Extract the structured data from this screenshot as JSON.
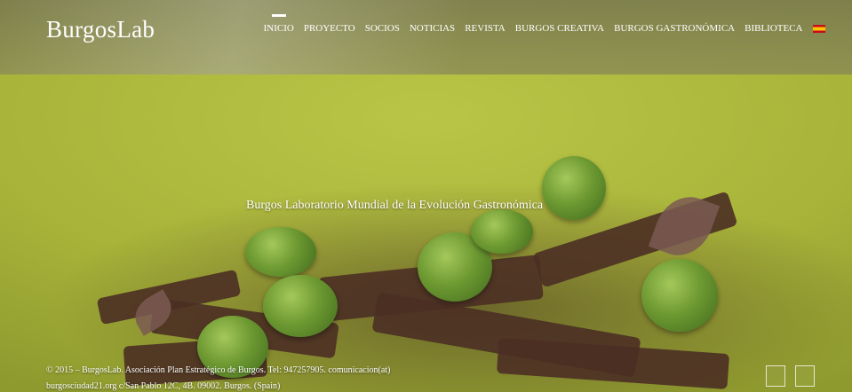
{
  "brand": {
    "logo_text": "BurgosLab"
  },
  "nav": {
    "items": [
      {
        "label": "INICIO",
        "active": true
      },
      {
        "label": "PROYECTO"
      },
      {
        "label": "SOCIOS"
      },
      {
        "label": "NOTICIAS"
      },
      {
        "label": "REVISTA"
      },
      {
        "label": "BURGOS CREATIVA"
      },
      {
        "label": "BURGOS GASTRONÓMICA"
      },
      {
        "label": "BIBLIOTECA"
      }
    ],
    "language_icon": "spain-flag-icon"
  },
  "hero": {
    "tagline": "Burgos Laboratorio Mundial de la Evolución Gastronómica"
  },
  "footer": {
    "line1": "© 2015 – BurgosLab. Asociación Plan Estratégico de Burgos. Tel: 947257905. comunicacion(at)",
    "line2": "burgosciudad21.org c/San Pablo 12C, 4B. 09002. Burgos. (Spain)"
  },
  "slider": {
    "prev_icon": "slider-prev-icon",
    "next_icon": "slider-next-icon"
  },
  "colors": {
    "background": "#a8b43a",
    "text": "#ffffff"
  }
}
